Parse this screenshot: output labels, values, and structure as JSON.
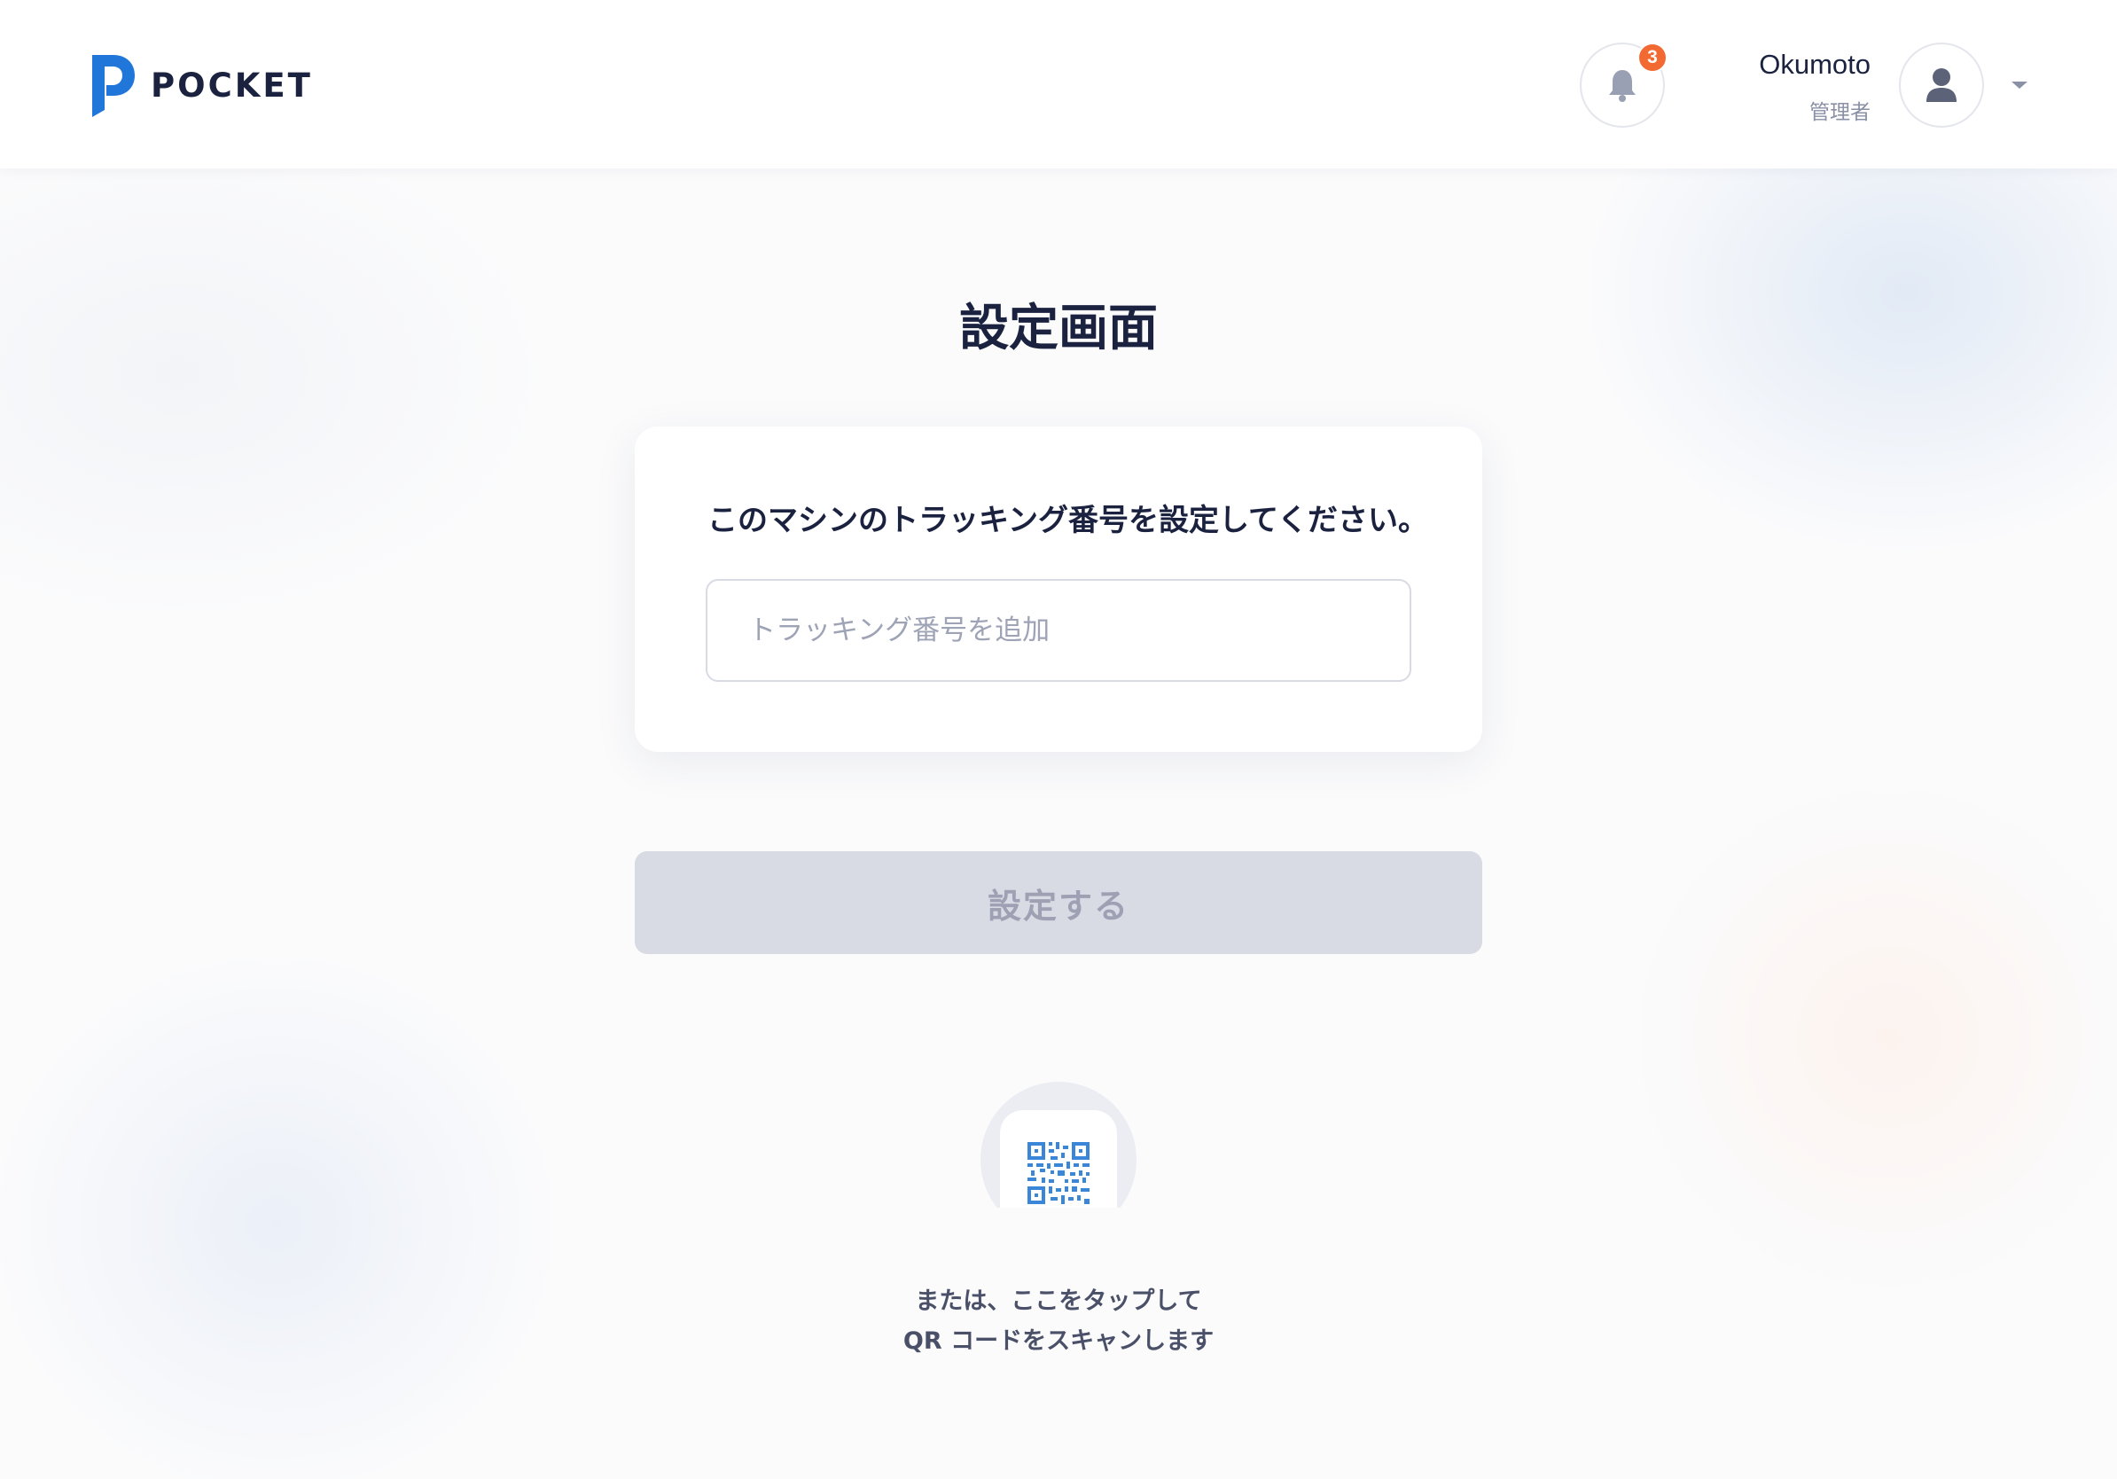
{
  "header": {
    "brand": "POCKET",
    "notifications": {
      "count": "3"
    },
    "user": {
      "name": "Okumoto",
      "role": "管理者"
    }
  },
  "main": {
    "title": "設定画面",
    "card": {
      "label": "このマシンのトラッキング番号を設定してください。",
      "input": {
        "placeholder": "トラッキング番号を追加",
        "value": ""
      }
    },
    "submit_label": "設定する",
    "qr": {
      "icon": "qr-code-icon",
      "caption_line1": "または、ここをタップして",
      "caption_line2": "QR コードをスキャンします"
    }
  },
  "colors": {
    "brand": "#2176d9",
    "badge": "#f26a31",
    "text_primary": "#1a2240",
    "button_disabled_bg": "#d9dbe4",
    "button_disabled_text": "#9da1b3",
    "qr_blue": "#3a86d8"
  }
}
